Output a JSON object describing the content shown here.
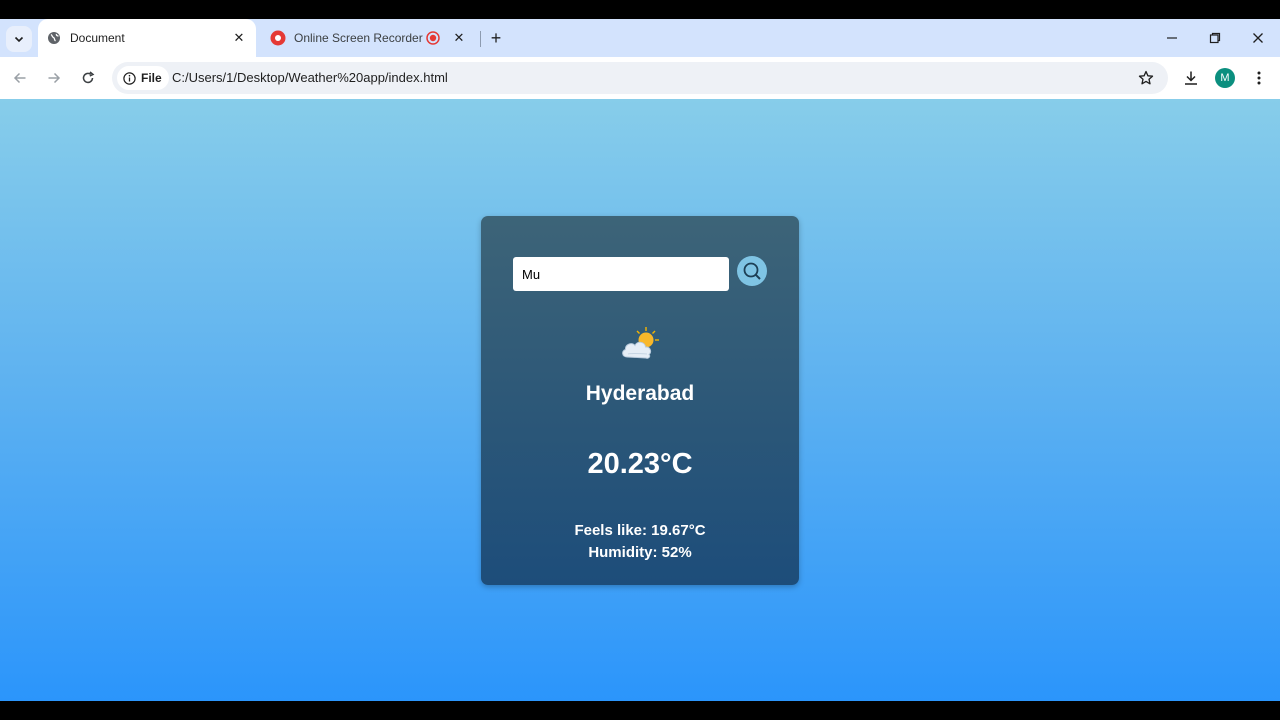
{
  "browser": {
    "tabs": [
      {
        "title": "Document",
        "favicon": "globe-icon",
        "active": true
      },
      {
        "title": "Online Screen Recorder",
        "favicon": "record-icon",
        "active": false,
        "recording": true
      }
    ],
    "address": {
      "chip_label": "File",
      "url": "C:/Users/1/Desktop/Weather%20app/index.html"
    },
    "profile_initial": "M",
    "colors": {
      "tabstrip": "#d3e3fd",
      "avatar": "#0b8f7f",
      "recording": "#e53935"
    }
  },
  "weather": {
    "search_value": "Mu",
    "icon": "sun-behind-cloud-icon",
    "city": "Hyderabad",
    "temperature": "20.23°C",
    "feels_like": "Feels like: 19.67°C",
    "humidity": "Humidity: 52%"
  }
}
